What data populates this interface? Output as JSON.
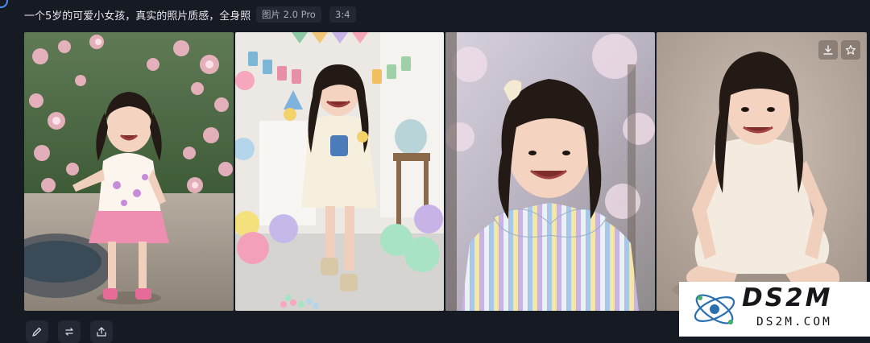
{
  "prompt": {
    "text": "一个5岁的可爱小女孩，真实的照片质感，全身照",
    "model_tag": "图片 2.0 Pro",
    "ratio_tag": "3:4"
  },
  "gallery": {
    "images": [
      {
        "icon": "photo-girl-garden-pink-skirt"
      },
      {
        "icon": "photo-girl-birthday-balloons"
      },
      {
        "icon": "photo-girl-striped-dress-portrait"
      },
      {
        "icon": "photo-girl-sitting-studio"
      }
    ],
    "hover_actions": [
      {
        "icon": "download-icon"
      },
      {
        "icon": "star-icon"
      }
    ]
  },
  "toolbar": {
    "actions": [
      {
        "icon": "edit-icon"
      },
      {
        "icon": "regenerate-icon"
      },
      {
        "icon": "share-icon"
      }
    ]
  },
  "watermark": {
    "name": "DS2M",
    "domain": "DS2M.COM"
  },
  "colors": {
    "background": "#161a23",
    "accent": "#4b8df8",
    "tag_bg": "#222733"
  }
}
